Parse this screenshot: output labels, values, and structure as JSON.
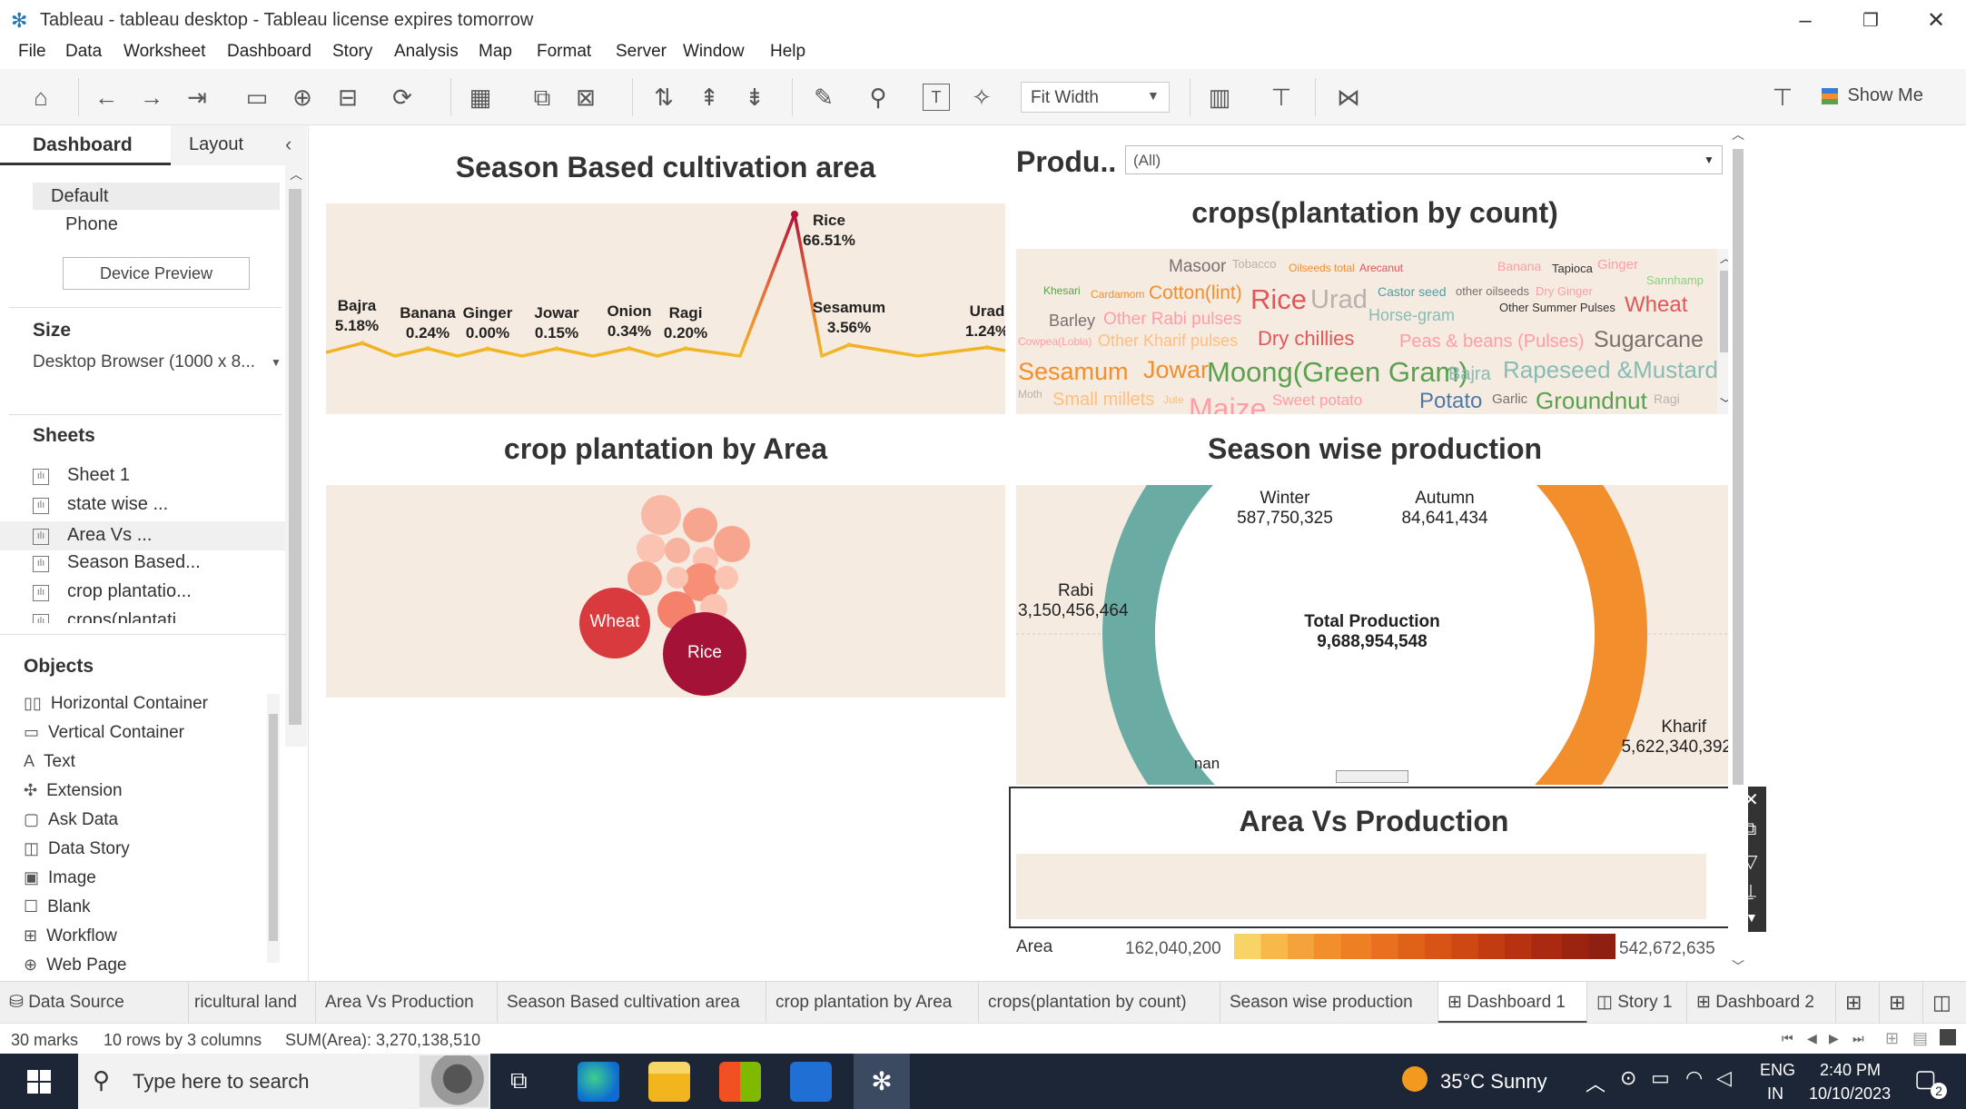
{
  "window": {
    "title": "Tableau - tableau desktop - Tableau license expires tomorrow"
  },
  "menu": [
    "File",
    "Data",
    "Worksheet",
    "Dashboard",
    "Story",
    "Analysis",
    "Map",
    "Format",
    "Server",
    "Window",
    "Help"
  ],
  "toolbar": {
    "fit": "Fit Width",
    "show_me": "Show Me"
  },
  "left": {
    "tab_dashboard": "Dashboard",
    "tab_layout": "Layout",
    "device_default": "Default",
    "device_phone": "Phone",
    "device_preview": "Device Preview",
    "size_heading": "Size",
    "size_value": "Desktop Browser (1000 x 8...",
    "sheets_heading": "Sheets",
    "sheets": [
      "Sheet 1",
      "state wise ...",
      "Area Vs ...",
      "Season Based...",
      "crop plantatio...",
      "crops(plantati..."
    ],
    "objects_heading": "Objects",
    "objects": [
      "Horizontal Container",
      "Vertical Container",
      "Text",
      "Extension",
      "Ask Data",
      "Data Story",
      "Image",
      "Blank",
      "Workflow",
      "Web Page"
    ]
  },
  "dashboard": {
    "season_title": "Season Based cultivation area",
    "area_title": "crop plantation by Area",
    "product_filter_label": "Produ..",
    "product_filter_value": "(All)",
    "crops_count_title": "crops(plantation by count)",
    "season_prod_title": "Season wise production",
    "area_vs_prod_title": "Area Vs Production",
    "legend_label": "Area",
    "legend_min": "162,040,200",
    "legend_max": "542,672,635"
  },
  "chart_data": [
    {
      "type": "line",
      "title": "Season Based cultivation area",
      "points": [
        {
          "name": "Bajra",
          "value": "5.18%",
          "y": 5.18
        },
        {
          "name": "Banana",
          "value": "0.24%",
          "y": 0.24
        },
        {
          "name": "Ginger",
          "value": "0.00%",
          "y": 0.0
        },
        {
          "name": "Jowar",
          "value": "0.15%",
          "y": 0.15
        },
        {
          "name": "Onion",
          "value": "0.34%",
          "y": 0.34
        },
        {
          "name": "Ragi",
          "value": "0.20%",
          "y": 0.2
        },
        {
          "name": "Rice",
          "value": "66.51%",
          "y": 66.51
        },
        {
          "name": "Sesamum",
          "value": "3.56%",
          "y": 3.56
        },
        {
          "name": "Urad",
          "value": "1.24%",
          "y": 1.24
        }
      ]
    },
    {
      "type": "bubble",
      "title": "crop plantation by Area",
      "labels": [
        "Wheat",
        "Rice"
      ]
    },
    {
      "type": "pie",
      "title": "Season wise production",
      "center_label": "Total Production",
      "center_value": "9,688,954,548",
      "slices": [
        {
          "name": "Winter",
          "label": "587,750,325",
          "value": 587750325
        },
        {
          "name": "Autumn",
          "label": "84,641,434",
          "value": 84641434
        },
        {
          "name": "Rabi",
          "label": "3,150,456,464",
          "value": 3150456464
        },
        {
          "name": "Kharif",
          "label": "5,622,340,392",
          "value": 5622340392
        },
        {
          "name": "nan",
          "label": "",
          "value": 0
        }
      ]
    }
  ],
  "wordcloud": [
    "Masoor",
    "Tobacco",
    "Oilseeds total",
    "Arecanut",
    "Banana",
    "Tapioca",
    "Ginger",
    "Khesari",
    "Cardamom",
    "Cotton(lint)",
    "Rice",
    "Urad",
    "Castor seed",
    "other oilseeds",
    "Dry Ginger",
    "Sannhamp",
    "Barley",
    "Other Rabi pulses",
    "Horse-gram",
    "Other Summer Pulses",
    "Wheat",
    "Cowpea(Lobia)",
    "Other Kharif pulses",
    "Dry chillies",
    "Peas & beans (Pulses)",
    "Sugarcane",
    "Sesamum",
    "Jowar",
    "Moong(Green Gram)",
    "Bajra",
    "Rapeseed &Mustard",
    "Moth",
    "Small millets",
    "Jute",
    "Maize",
    "Sweet potato",
    "Potato",
    "Garlic",
    "Groundnut",
    "Ragi"
  ],
  "tabs": [
    "Data Source",
    "ricultural land",
    "Area Vs Production",
    "Season Based cultivation area",
    "crop plantation by Area",
    "crops(plantation by count)",
    "Season wise production",
    "Dashboard 1",
    "Story 1",
    "Dashboard 2"
  ],
  "status": {
    "marks": "30 marks",
    "rows": "10 rows by 3 columns",
    "sum": "SUM(Area): 3,270,138,510"
  },
  "taskbar": {
    "search": "Type here to search",
    "weather": "35°C  Sunny",
    "lang1": "ENG",
    "lang2": "IN",
    "time": "2:40 PM",
    "date": "10/10/2023",
    "notif": "2"
  },
  "colors": {
    "panel_bg": "#f6ebe0",
    "teal": "#6aaba4",
    "orange": "#f28e2c",
    "rice": "#a41337",
    "wheat": "#d93a3e",
    "line": "#f4b923"
  }
}
